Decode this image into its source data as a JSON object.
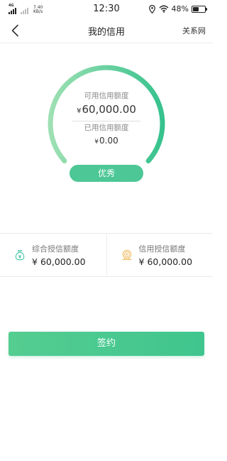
{
  "status_bar": {
    "signal_label": "4G",
    "net_speed_value": "7.40",
    "net_speed_unit": "KB/s",
    "time": "12:30",
    "battery_percent": "48%",
    "battery_level": 0.48
  },
  "nav": {
    "title": "我的信用",
    "action_label": "关系网",
    "back_icon": "chevron-left-icon"
  },
  "gauge": {
    "available_label": "可用信用额度",
    "currency_symbol": "¥",
    "available_amount": "60,000.00",
    "used_label": "已用信用额度",
    "used_amount": "0.00",
    "rating": "优秀",
    "colors": {
      "start": "#9ee0b3",
      "end": "#36c28d"
    }
  },
  "quota": {
    "items": [
      {
        "label": "综合授信额度",
        "currency_symbol": "¥",
        "value": "60,000.00",
        "icon": "money-bag-icon",
        "icon_color": "#48c5a5"
      },
      {
        "label": "信用授信额度",
        "currency_symbol": "¥",
        "value": "60,000.00",
        "icon": "credit-medal-icon",
        "icon_color": "#f0b85a"
      }
    ]
  },
  "sign": {
    "label": "签约"
  },
  "theme": {
    "accent": "#4cc795"
  }
}
